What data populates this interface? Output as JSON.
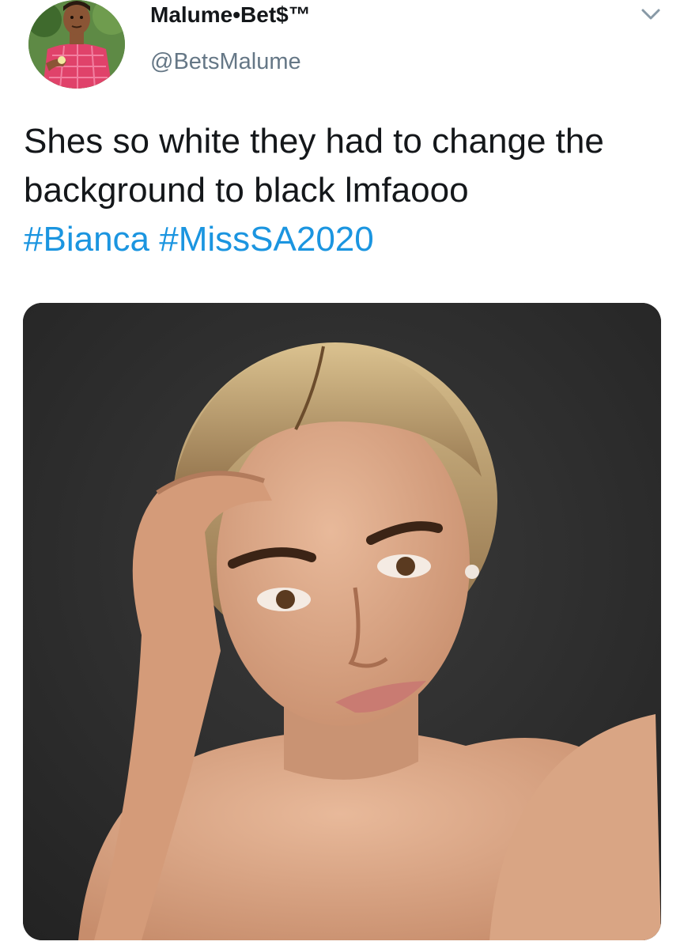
{
  "author": {
    "display_name": "Malume•Bet$™",
    "handle": "@BetsMalume",
    "avatar_icon": "cartoon-avatar"
  },
  "tweet": {
    "text": "Shes so white they had to change the background to black lmfaooo",
    "hashtags": [
      "#Bianca",
      "#MissSA2020"
    ]
  },
  "menu_icon": "chevron-down-icon",
  "colors": {
    "text": "#14171a",
    "secondary": "#657786",
    "link": "#1b95e0",
    "photo_background": "#2d2d2d"
  }
}
